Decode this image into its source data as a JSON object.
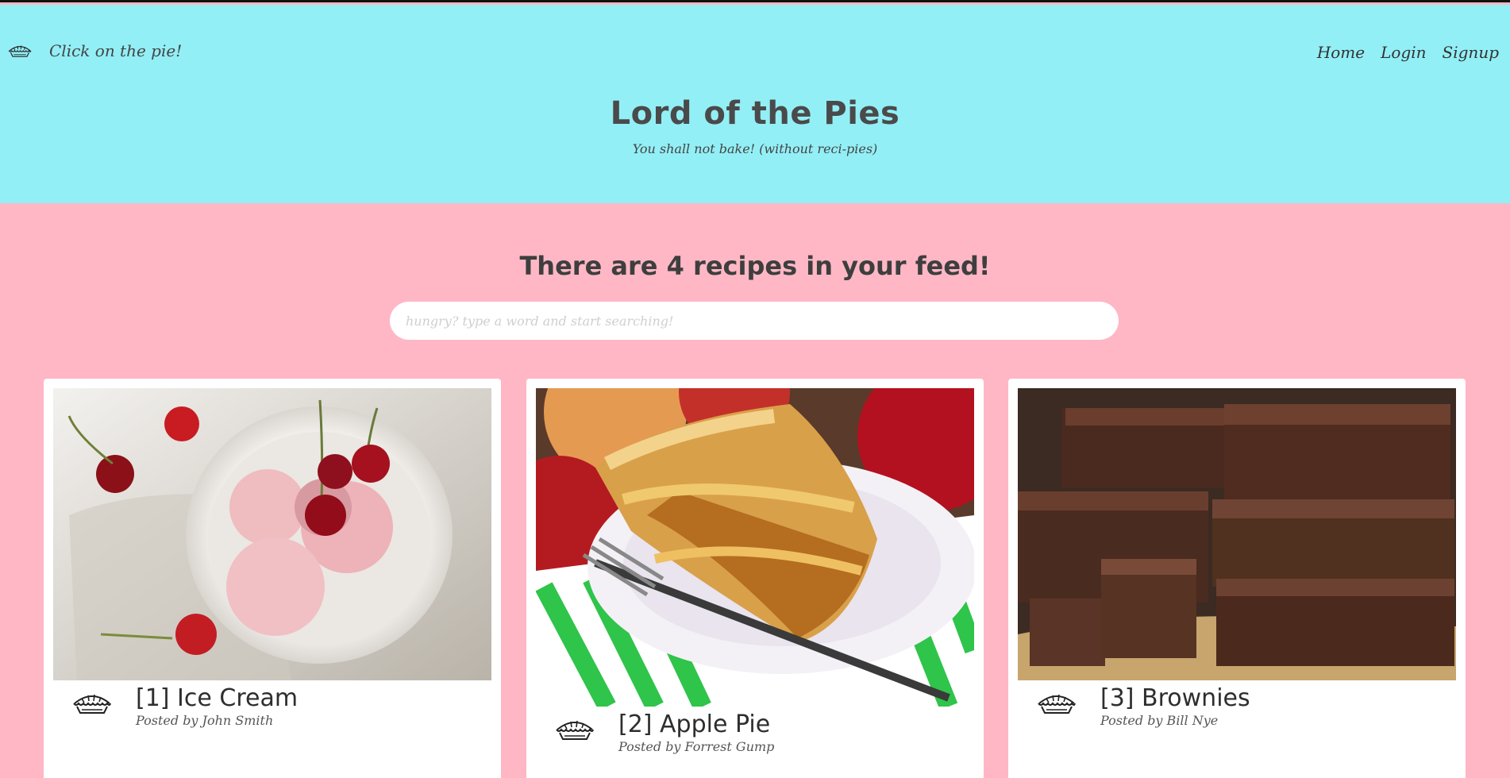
{
  "header": {
    "brand_label": "Click on the pie!",
    "nav": [
      {
        "label": "Home"
      },
      {
        "label": "Login"
      },
      {
        "label": "Signup"
      }
    ],
    "title": "Lord of the Pies",
    "subtitle": "You shall not bake! (without reci-pies)"
  },
  "feed": {
    "heading": "There are 4 recipes in your feed!",
    "search_placeholder": "hungry? type a word and start searching!",
    "recipes": [
      {
        "title": "[1] Ice Cream",
        "author": "Posted by John Smith"
      },
      {
        "title": "[2] Apple Pie",
        "author": "Posted by Forrest Gump"
      },
      {
        "title": "[3] Brownies",
        "author": "Posted by Bill Nye"
      }
    ]
  },
  "icons": {
    "brand": "pie-icon",
    "card": "pie-icon"
  },
  "colors": {
    "header_bg": "#93eff6",
    "page_bg": "#ffb7c5",
    "card_bg": "#ffffff"
  }
}
